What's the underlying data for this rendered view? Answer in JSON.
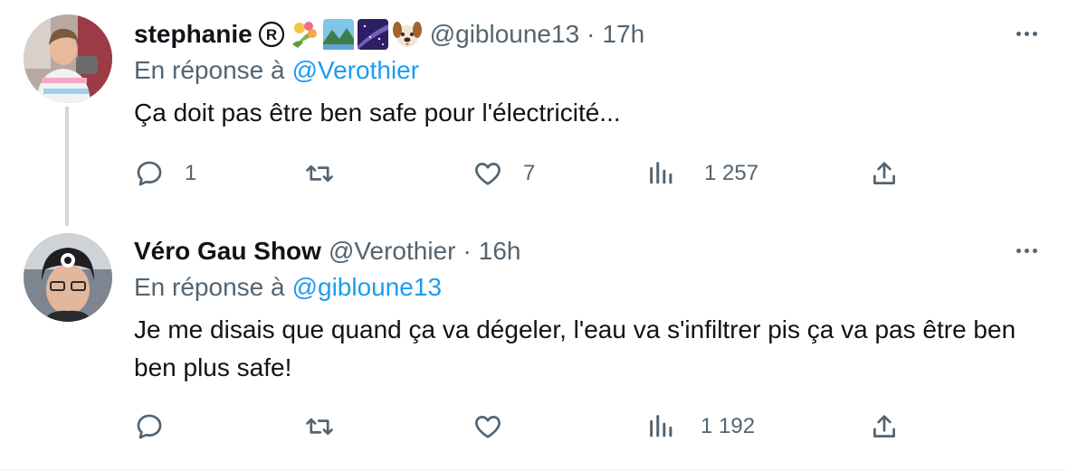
{
  "tweets": [
    {
      "display_name": "stephanie",
      "handle": "@gibloune13",
      "time": "17h",
      "reply_label": "En réponse à",
      "reply_to": "@Verothier",
      "text": "Ça doit pas être ben safe pour l'électricité...",
      "counts": {
        "replies": "1",
        "retweets": "",
        "likes": "7",
        "views": "1 257"
      },
      "name_emojis": [
        "bouquet-emoji",
        "landscape-emoji",
        "milky-way-emoji",
        "dog-face-emoji"
      ]
    },
    {
      "display_name": "Véro Gau Show",
      "handle": "@Verothier",
      "time": "16h",
      "reply_label": "En réponse à",
      "reply_to": "@gibloune13",
      "text": "Je me disais que quand ça va  dégeler, l'eau va s'infiltrer pis ça va pas être ben ben plus safe!",
      "counts": {
        "replies": "",
        "retweets": "",
        "likes": "",
        "views": "1 192"
      }
    }
  ],
  "colors": {
    "text": "#0f1419",
    "secondary": "#536471",
    "link": "#1d9bf0",
    "thread_line": "#cfd9de"
  },
  "separator": "·"
}
